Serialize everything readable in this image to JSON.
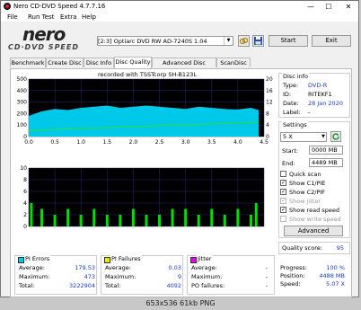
{
  "window": {
    "title": "Nero CD-DVD Speed 4.7.7.16",
    "minimize": "—",
    "maximize": "☐",
    "close": "✕"
  },
  "menu": [
    "File",
    "Run Test",
    "Extra",
    "Help"
  ],
  "logo": {
    "nero": "nero",
    "cddvd": "CD·DVD SPEED"
  },
  "toolbar": {
    "drive": "[2:3]   Optiarc DVD RW AD-7240S 1.04",
    "start": "Start",
    "exit": "Exit"
  },
  "tabs": [
    "Benchmark",
    "Create Disc",
    "Disc Info",
    "Disc Quality",
    "Advanced Disc Quality",
    "ScanDisc"
  ],
  "active_tab": "Disc Quality",
  "chart_caption": "recorded with TSSTcorp SH-B123L",
  "disc_info": {
    "title": "Disc info",
    "type_k": "Type:",
    "type_v": "DVD-R",
    "id_k": "ID:",
    "id_v": "RITEKF1",
    "date_k": "Date:",
    "date_v": "28 Jan 2020",
    "label_k": "Label:",
    "label_v": "-"
  },
  "settings": {
    "title": "Settings",
    "speed": "5 X",
    "start_k": "Start:",
    "start_v": "0000 MB",
    "end_k": "End:",
    "end_v": "4489 MB",
    "checks": [
      {
        "label": "Quick scan",
        "checked": false,
        "disabled": false
      },
      {
        "label": "Show C1/PIE",
        "checked": true,
        "disabled": false
      },
      {
        "label": "Show C2/PIF",
        "checked": true,
        "disabled": false
      },
      {
        "label": "Show jitter",
        "checked": true,
        "disabled": true
      },
      {
        "label": "Show read speed",
        "checked": true,
        "disabled": false
      },
      {
        "label": "Show write speed",
        "checked": false,
        "disabled": true
      }
    ],
    "advanced": "Advanced"
  },
  "quality": {
    "k": "Quality score:",
    "v": "95"
  },
  "progress": {
    "progress_k": "Progress:",
    "progress_v": "100 %",
    "position_k": "Position:",
    "position_v": "4488 MB",
    "speed_k": "Speed:",
    "speed_v": "5.07 X"
  },
  "pi_errors": {
    "title": "PI Errors",
    "color": "#00c8e8",
    "avg_k": "Average:",
    "avg_v": "179.53",
    "max_k": "Maximum:",
    "max_v": "473",
    "tot_k": "Total:",
    "tot_v": "3222904"
  },
  "pi_failures": {
    "title": "PI Failures",
    "color": "#e8e800",
    "avg_k": "Average:",
    "avg_v": "0.03",
    "max_k": "Maximum:",
    "max_v": "9",
    "tot_k": "Total:",
    "tot_v": "4092"
  },
  "jitter": {
    "title": "Jitter",
    "color": "#e800e8",
    "avg_k": "Average:",
    "avg_v": "-",
    "max_k": "Maximum:",
    "max_v": "-",
    "po_k": "PO failures:",
    "po_v": "-"
  },
  "statusbar": "653x536 61kb PNG",
  "chart_data": [
    {
      "type": "area",
      "name": "PI Errors",
      "x_range": [
        0,
        4.5
      ],
      "ylim": [
        0,
        500
      ],
      "y2lim": [
        0,
        20
      ],
      "yticks": [
        0,
        100,
        200,
        300,
        400,
        500
      ],
      "y2ticks": [
        0,
        4,
        8,
        12,
        16,
        20
      ],
      "xticks": [
        "0.0",
        "0.5",
        "1.0",
        "1.5",
        "2.0",
        "2.5",
        "3.0",
        "3.5",
        "4.0",
        "4.5"
      ],
      "color": "#00c8e8",
      "x": [
        0,
        0.25,
        0.5,
        0.75,
        1.0,
        1.25,
        1.5,
        1.75,
        2.0,
        2.25,
        2.5,
        2.75,
        3.0,
        3.25,
        3.5,
        3.75,
        4.0,
        4.25,
        4.4
      ],
      "values": [
        180,
        220,
        240,
        230,
        250,
        260,
        270,
        250,
        260,
        270,
        260,
        250,
        240,
        260,
        250,
        240,
        235,
        250,
        230
      ],
      "read_speed": {
        "x": [
          0,
          4.4
        ],
        "values": [
          2.2,
          5.0
        ]
      }
    },
    {
      "type": "bar",
      "name": "PI Failures",
      "x_range": [
        0,
        4.5
      ],
      "ylim": [
        0,
        10
      ],
      "yticks": [
        0,
        2,
        4,
        6,
        8,
        10
      ],
      "xticks": [
        "0.0",
        "0.5",
        "1.0",
        "1.5",
        "2.0",
        "2.5",
        "3.0",
        "3.5",
        "4.0",
        "4.5"
      ],
      "color": "#00e000",
      "x": [
        0.05,
        0.25,
        0.5,
        0.75,
        1.0,
        1.25,
        1.5,
        1.75,
        2.0,
        2.25,
        2.5,
        2.75,
        3.0,
        3.25,
        3.5,
        3.75,
        4.0,
        4.25,
        4.35
      ],
      "values": [
        4,
        3,
        2,
        3,
        2,
        3,
        2,
        2,
        3,
        2,
        2,
        3,
        3,
        2,
        3,
        2,
        3,
        2,
        4
      ]
    }
  ]
}
